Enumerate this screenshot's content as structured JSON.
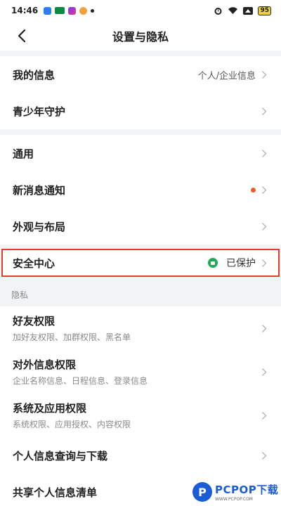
{
  "status_bar": {
    "time": "14:46",
    "battery": "95"
  },
  "nav": {
    "title": "设置与隐私"
  },
  "group1": [
    {
      "title": "我的信息",
      "value": "个人/企业信息"
    },
    {
      "title": "青少年守护",
      "value": ""
    }
  ],
  "group2": [
    {
      "title": "通用"
    },
    {
      "title": "新消息通知"
    },
    {
      "title": "外观与布局"
    }
  ],
  "security": {
    "title": "安全中心",
    "status": "已保护"
  },
  "privacy": {
    "header": "隐私",
    "items": [
      {
        "title": "好友权限",
        "sub": "加好友权限、加群权限、黑名单"
      },
      {
        "title": "对外信息权限",
        "sub": "企业名称信息、日程信息、登录信息"
      },
      {
        "title": "系统及应用权限",
        "sub": "系统权限、应用授权、内容权限"
      }
    ],
    "plain_items": [
      {
        "title": "个人信息查询与下载"
      },
      {
        "title": "共享个人信息清单"
      }
    ]
  },
  "watermark": {
    "main": "PCPOP下载",
    "sub": "WWW.PCPOP.COM"
  },
  "colors": {
    "highlight_border": "#e53935",
    "notification_dot": "#f05a28",
    "shield_green": "#1faa55",
    "brand_blue": "#1a5bd6"
  }
}
